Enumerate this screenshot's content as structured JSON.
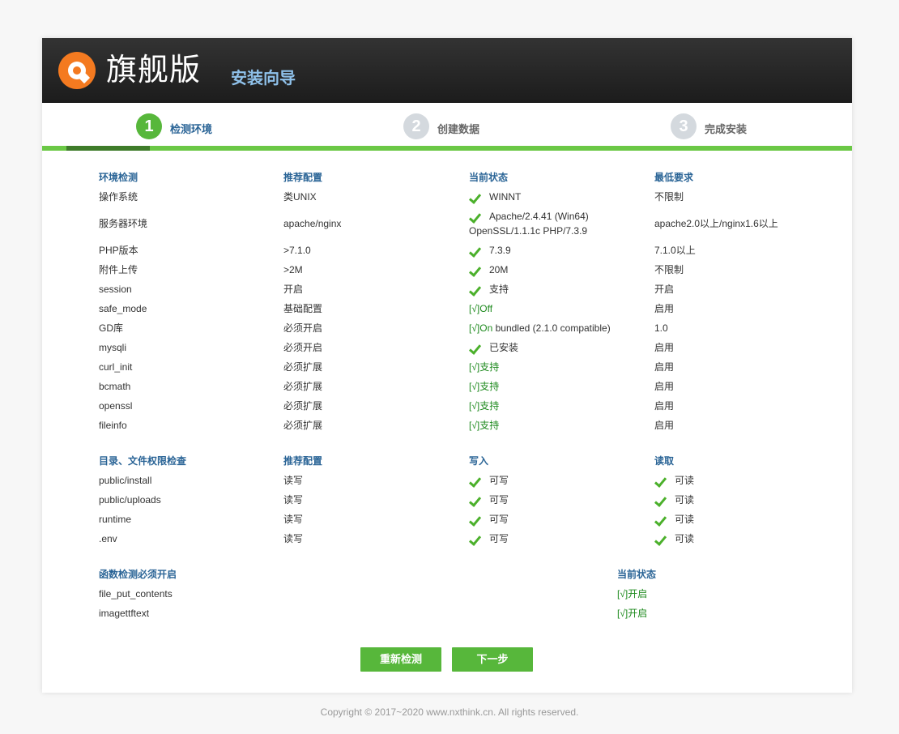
{
  "header": {
    "brand": "旗舰版",
    "subtitle": "安装向导"
  },
  "steps": [
    {
      "num": "1",
      "label": "检测环境"
    },
    {
      "num": "2",
      "label": "创建数据"
    },
    {
      "num": "3",
      "label": "完成安装"
    }
  ],
  "progress": {
    "step": 1,
    "total": 3
  },
  "env": {
    "headers": [
      "环境检测",
      "推荐配置",
      "当前状态",
      "最低要求"
    ],
    "rows": [
      {
        "name": "操作系统",
        "rec": "类UNIX",
        "status": "WINNT",
        "min": "不限制"
      },
      {
        "name": "服务器环境",
        "rec": "apache/nginx",
        "status": "Apache/2.4.41 (Win64) OpenSSL/1.1.1c PHP/7.3.9",
        "min": "apache2.0以上/nginx1.6以上"
      },
      {
        "name": "PHP版本",
        "rec": ">7.1.0",
        "status": "7.3.9",
        "min": "7.1.0以上"
      },
      {
        "name": "附件上传",
        "rec": ">2M",
        "status": "20M",
        "min": "不限制"
      },
      {
        "name": "session",
        "rec": "开启",
        "status": "支持",
        "min": "开启"
      },
      {
        "name": "safe_mode",
        "rec": "基础配置",
        "status_mark": "[√]Off",
        "min": "启用"
      },
      {
        "name": "GD库",
        "rec": "必须开启",
        "status_mark": "[√]On",
        "status_extra": " bundled (2.1.0 compatible)",
        "min": "1.0"
      },
      {
        "name": "mysqli",
        "rec": "必须开启",
        "status": "已安装",
        "min": "启用"
      },
      {
        "name": "curl_init",
        "rec": "必须扩展",
        "status_mark": "[√]支持",
        "min": "启用"
      },
      {
        "name": "bcmath",
        "rec": "必须扩展",
        "status_mark": "[√]支持",
        "min": "启用"
      },
      {
        "name": "openssl",
        "rec": "必须扩展",
        "status_mark": "[√]支持",
        "min": "启用"
      },
      {
        "name": "fileinfo",
        "rec": "必须扩展",
        "status_mark": "[√]支持",
        "min": "启用"
      }
    ]
  },
  "dirs": {
    "headers": [
      "目录、文件权限检查",
      "推荐配置",
      "写入",
      "读取"
    ],
    "rows": [
      {
        "path": "public/install",
        "rec": "读写",
        "write": "可写",
        "read": "可读"
      },
      {
        "path": "public/uploads",
        "rec": "读写",
        "write": "可写",
        "read": "可读"
      },
      {
        "path": "runtime",
        "rec": "读写",
        "write": "可写",
        "read": "可读"
      },
      {
        "path": ".env",
        "rec": "读写",
        "write": "可写",
        "read": "可读"
      }
    ]
  },
  "funcs": {
    "headers": [
      "函数检测必须开启",
      "当前状态"
    ],
    "rows": [
      {
        "name": "file_put_contents",
        "status": "[√]开启"
      },
      {
        "name": "imagettftext",
        "status": "[√]开启"
      }
    ]
  },
  "buttons": {
    "recheck": "重新检测",
    "next": "下一步"
  },
  "footer": "Copyright © 2017~2020 www.nxthink.cn. All rights reserved.",
  "colors": {
    "accent": "#57b73b",
    "header_blue": "#2a6496",
    "ok_green": "#4bb02b"
  }
}
